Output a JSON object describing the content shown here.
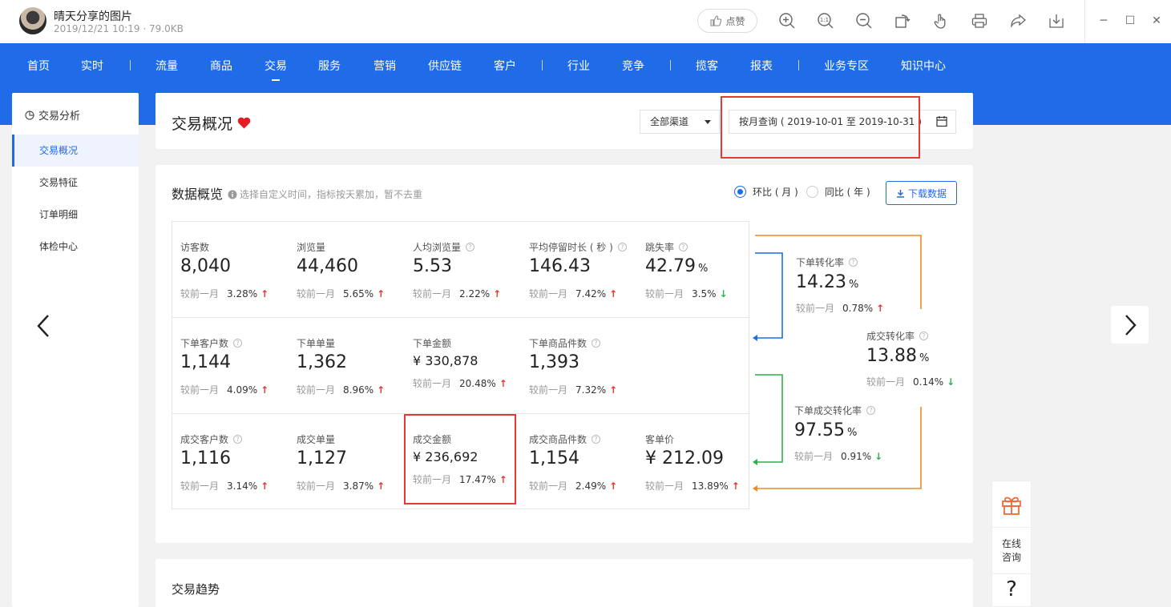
{
  "viewer": {
    "title": "晴天分享的图片",
    "meta": "2019/12/21 10:19 · 79.0KB",
    "like_label": "点赞"
  },
  "nav": {
    "items": [
      "首页",
      "实时",
      "流量",
      "商品",
      "交易",
      "服务",
      "营销",
      "供应链",
      "客户",
      "行业",
      "竞争",
      "揽客",
      "报表",
      "业务专区",
      "知识中心"
    ],
    "active": "交易"
  },
  "sidebar": {
    "title": "交易分析",
    "items": [
      "交易概况",
      "交易特征",
      "订单明细",
      "体检中心"
    ],
    "active": "交易概况"
  },
  "header": {
    "title": "交易概况",
    "channel": "全部渠道",
    "date_range": "按月查询 ( 2019-10-01 至 2019-10-31 )"
  },
  "overview": {
    "title": "数据概览",
    "hint": "选择自定义时间，指标按天累加，暂不去重",
    "radio_mom": "环比 ( 月 )",
    "radio_yoy": "同比 ( 年 )",
    "download": "下载数据",
    "compare_label": "较前一月",
    "rows": [
      [
        {
          "label": "访客数",
          "value": "8,040",
          "change": "3.28%",
          "dir": "up"
        },
        {
          "label": "浏览量",
          "value": "44,460",
          "change": "5.65%",
          "dir": "up"
        },
        {
          "label": "人均浏览量",
          "value": "5.53",
          "change": "2.22%",
          "dir": "up",
          "help": true
        },
        {
          "label": "平均停留时长 ( 秒 )",
          "value": "146.43",
          "change": "7.42%",
          "dir": "up",
          "help": true
        },
        {
          "label": "跳失率",
          "value": "42.79",
          "unit": "%",
          "change": "3.5%",
          "dir": "down",
          "help": true
        }
      ],
      [
        {
          "label": "下单客户数",
          "value": "1,144",
          "change": "4.09%",
          "dir": "up",
          "help": true
        },
        {
          "label": "下单单量",
          "value": "1,362",
          "change": "8.96%",
          "dir": "up"
        },
        {
          "label": "下单金额",
          "value": "¥ 330,878",
          "change": "20.48%",
          "dir": "up",
          "small": true
        },
        {
          "label": "下单商品件数",
          "value": "1,393",
          "change": "7.32%",
          "dir": "up",
          "help": true
        }
      ],
      [
        {
          "label": "成交客户数",
          "value": "1,116",
          "change": "3.14%",
          "dir": "up",
          "help": true
        },
        {
          "label": "成交单量",
          "value": "1,127",
          "change": "3.87%",
          "dir": "up"
        },
        {
          "label": "成交金额",
          "value": "¥ 236,692",
          "change": "17.47%",
          "dir": "up",
          "small": true
        },
        {
          "label": "成交商品件数",
          "value": "1,154",
          "change": "2.49%",
          "dir": "up",
          "help": true
        },
        {
          "label": "客单价",
          "value": "¥ 212.09",
          "change": "13.89%",
          "dir": "up"
        }
      ]
    ],
    "conversions": [
      {
        "label": "下单转化率",
        "value": "14.23",
        "unit": "%",
        "change": "0.78%",
        "dir": "up"
      },
      {
        "label": "成交转化率",
        "value": "13.88",
        "unit": "%",
        "change": "0.14%",
        "dir": "down"
      },
      {
        "label": "下单成交转化率",
        "value": "97.55",
        "unit": "%",
        "change": "0.91%",
        "dir": "down"
      }
    ]
  },
  "trend": {
    "title": "交易趋势"
  },
  "float_panel": {
    "online": "在线咨询",
    "help": "?"
  },
  "colors": {
    "brand": "#1f6be8",
    "up": "#e53935",
    "down": "#2bb24c",
    "highlight": "#e53935",
    "flow_blue": "#1f6be8",
    "flow_green": "#2bb24c",
    "flow_orange": "#f08a24"
  }
}
